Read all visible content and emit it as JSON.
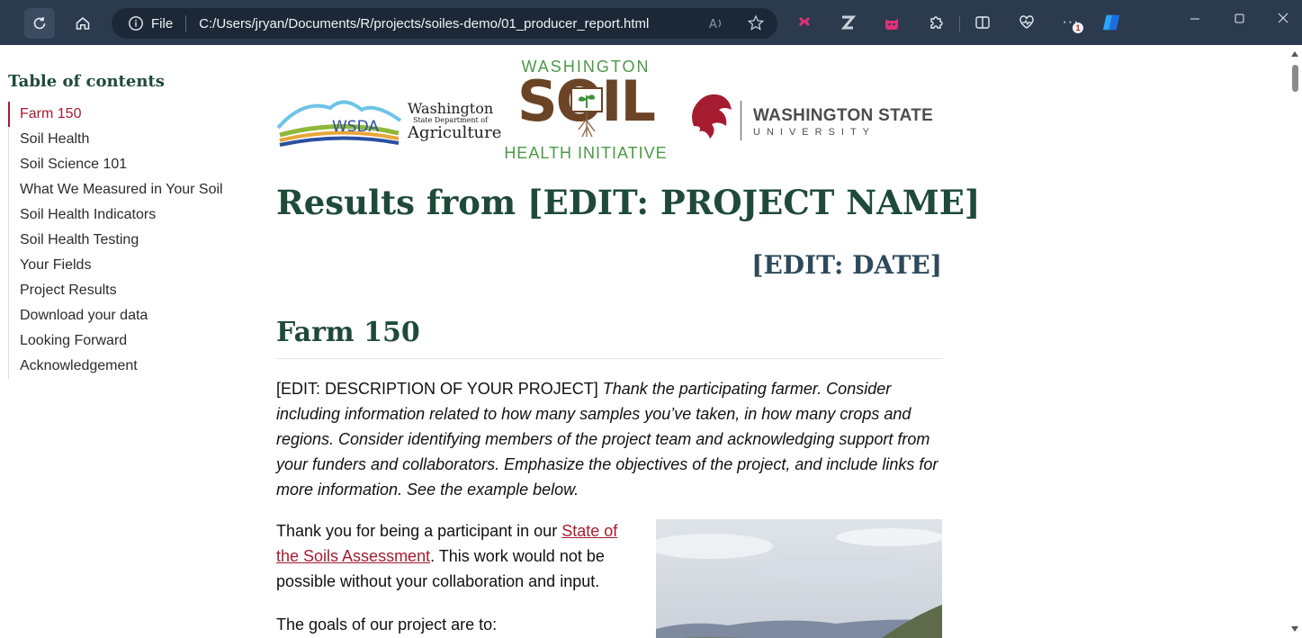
{
  "browser": {
    "address_prefix": "File",
    "url": "C:/Users/jryan/Documents/R/projects/soiles-demo/01_producer_report.html",
    "notification_count": "1"
  },
  "toc": {
    "title": "Table of contents",
    "items": [
      {
        "label": "Farm 150",
        "active": true
      },
      {
        "label": "Soil Health"
      },
      {
        "label": "Soil Science 101"
      },
      {
        "label": "What We Measured in Your Soil"
      },
      {
        "label": "Soil Health Indicators"
      },
      {
        "label": "Soil Health Testing"
      },
      {
        "label": "Your Fields"
      },
      {
        "label": "Project Results"
      },
      {
        "label": "Download your data"
      },
      {
        "label": "Looking Forward"
      },
      {
        "label": "Acknowledgement"
      }
    ]
  },
  "logos": {
    "wsda": "WSDA",
    "agency_line1": "Washington",
    "agency_line2": "State Department of",
    "agency_line3": "Agriculture",
    "soil_top": "WASHINGTON",
    "soil_main": "SOIL",
    "soil_bottom": "HEALTH INITIATIVE",
    "wsu_line1": "WASHINGTON STATE",
    "wsu_line2": "UNIVERSITY"
  },
  "report": {
    "title": "Results from [EDIT: PROJECT NAME]",
    "date": "[EDIT: DATE]",
    "section_title": "Farm 150",
    "description_prefix": "[EDIT: DESCRIPTION OF YOUR PROJECT]",
    "description_italic": "Thank the participating farmer. Consider including information related to how many samples you’ve taken, in how many crops and regions. Consider identifying members of the project team and acknowledging support from your funders and collaborators. Emphasize the objectives of the project, and include links for more information. See the example below.",
    "thanks_before_link": "Thank you for being a participant in our ",
    "thanks_link": "State of the Soils Assessment",
    "thanks_after_link": ". This work would not be possible without your collaboration and input.",
    "goals_intro": "The goals of our project are to:"
  }
}
